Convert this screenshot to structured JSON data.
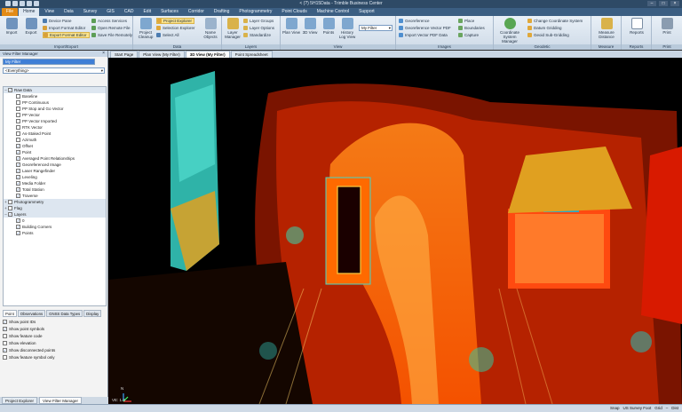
{
  "window": {
    "title": "< (?) 5H15Data - Trimble Business Center",
    "controls": [
      "–",
      "□",
      "×"
    ]
  },
  "ribbon_tabs": [
    "File",
    "Home",
    "View",
    "Data",
    "Survey",
    "GIS",
    "CAD",
    "Edit",
    "Surfaces",
    "Corridor",
    "Drafting",
    "Photogrammetry",
    "Point Clouds",
    "Machine Control",
    "Support"
  ],
  "ribbon": {
    "import_export": {
      "caption": "Import/Export",
      "import": "Import",
      "export": "Export",
      "device_pane": "Device Pane",
      "import_format_editor": "Import Format Editor",
      "export_format_editor": "Export Format Editor",
      "access_services": "Access Services",
      "open_remote_file": "Open Remote File",
      "save_file_remotely": "Save File Remotely"
    },
    "data": {
      "caption": "Data",
      "project_cleanup": "Project Cleanup",
      "project_explorer": "Project Explorer",
      "selection_explorer": "Selection Explorer",
      "select_all": "Select All",
      "name_objects": "Name Objects"
    },
    "layers": {
      "caption": "Layers",
      "layer_manager": "Layer Manager",
      "layer_groups": "Layer Groups",
      "layer_options": "Layer Options",
      "standardize": "Standardize"
    },
    "view": {
      "caption": "View",
      "plan_view": "Plan View",
      "view_3d": "3D View",
      "points": "Points",
      "history_log_view": "History Log View",
      "my_filter": "My Filter"
    },
    "images": {
      "caption": "Images",
      "georeference": "Georeference",
      "georeference_vector_pdf": "Georeference Vector PDF",
      "import_vector_pdf_data": "Import Vector PDF Data",
      "place": "Place",
      "boundaries": "Boundaries",
      "capture": "Capture"
    },
    "geodetic": {
      "caption": "Geodetic",
      "coordinate_system_manager": "Coordinate System Manager",
      "change_coordinate_system": "Change Coordinate System",
      "datum_gridding": "Datum Gridding",
      "geoid_sub_gridding": "Geoid Sub-Gridding"
    },
    "measure": {
      "caption": "Measure",
      "measure_distance": "Measure Distance"
    },
    "reports": {
      "caption": "Reports",
      "reports": "Reports"
    },
    "print": {
      "caption": "Print",
      "print": "Print"
    }
  },
  "left_panel": {
    "title": "View Filter Manager",
    "filter_name": "My Filter",
    "filter_scope": "<Everything>",
    "tree": [
      {
        "label": "Raw Data",
        "level": 0,
        "category": true,
        "checked": true,
        "toggle": "–"
      },
      {
        "label": "Baseline",
        "level": 1,
        "checked": false
      },
      {
        "label": "PP Continuous",
        "level": 1,
        "checked": false
      },
      {
        "label": "PP Stop and Go Vector",
        "level": 1,
        "checked": false
      },
      {
        "label": "PP Vector",
        "level": 1,
        "checked": false
      },
      {
        "label": "PP Vector Imported",
        "level": 1,
        "checked": false
      },
      {
        "label": "RTK Vector",
        "level": 1,
        "checked": false
      },
      {
        "label": "As-Staked Point",
        "level": 1,
        "checked": false
      },
      {
        "label": "Azimuth",
        "level": 1,
        "checked": false
      },
      {
        "label": "Offset",
        "level": 1,
        "checked": true
      },
      {
        "label": "Point",
        "level": 1,
        "checked": true
      },
      {
        "label": "Averaged Point Relationships",
        "level": 1,
        "checked": true
      },
      {
        "label": "Georeferenced Image",
        "level": 1,
        "checked": true
      },
      {
        "label": "Laser Rangefinder",
        "level": 1,
        "checked": true
      },
      {
        "label": "Leveling",
        "level": 1,
        "checked": true
      },
      {
        "label": "Media Folder",
        "level": 1,
        "checked": true
      },
      {
        "label": "Total Station",
        "level": 1,
        "checked": true
      },
      {
        "label": "Traverse",
        "level": 1,
        "checked": true
      },
      {
        "label": "Photogrammetry",
        "level": 0,
        "category": true,
        "checked": false,
        "toggle": "+"
      },
      {
        "label": "Flag",
        "level": 0,
        "category": true,
        "checked": false,
        "toggle": "+"
      },
      {
        "label": "Layers",
        "level": 0,
        "category": true,
        "checked": true,
        "toggle": "–"
      },
      {
        "label": "0",
        "level": 1,
        "checked": true
      },
      {
        "label": "Building Corners",
        "level": 1,
        "checked": true
      },
      {
        "label": "Points",
        "level": 1,
        "checked": true
      }
    ],
    "bottom_tabs": [
      "Point",
      "Observations",
      "GNSS Data Types",
      "Display"
    ],
    "options": [
      {
        "label": "Show point IDs",
        "checked": true
      },
      {
        "label": "Show point symbols",
        "checked": true
      },
      {
        "label": "Show feature code",
        "checked": false
      },
      {
        "label": "Show elevation",
        "checked": false
      },
      {
        "label": "Show disconnected points",
        "checked": true
      },
      {
        "label": "Show feature symbol only",
        "checked": false
      }
    ],
    "panel_tabs": [
      "Project Explorer",
      "View Filter Manager"
    ]
  },
  "doc_tabs": [
    "Start Page",
    "Plan View (My Filter)",
    "3D View (My Filter)",
    "Point Spreadsheet"
  ],
  "viewport": {
    "label": "VE: 1.0",
    "axis": "N"
  },
  "statusbar": [
    "Snap",
    "US Survey Foot",
    "Grid",
    "–",
    "Dist"
  ],
  "colors": {
    "ribbon_blue": "#3b5e82",
    "file_tab": "#e28b17",
    "highlight": "#fbe38c"
  }
}
